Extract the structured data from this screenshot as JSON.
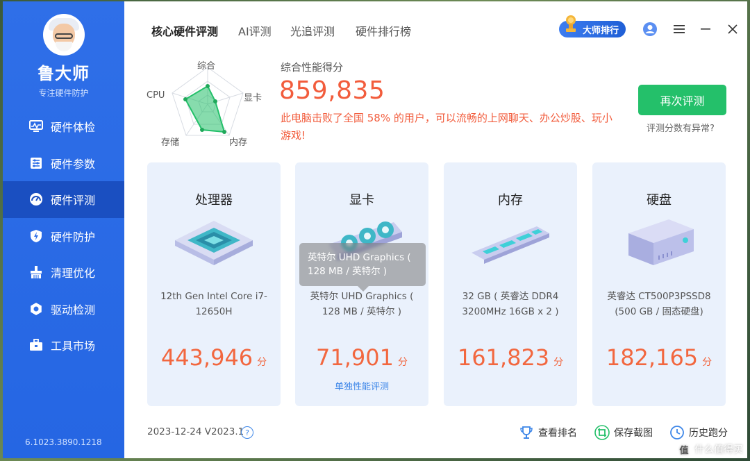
{
  "app": {
    "brand": "鲁大师",
    "subtitle": "专注硬件防护",
    "version": "6.1023.3890.1218"
  },
  "sidebar": {
    "items": [
      {
        "label": "硬件体检",
        "icon": "monitor-pulse-icon"
      },
      {
        "label": "硬件参数",
        "icon": "sliders-icon"
      },
      {
        "label": "硬件评测",
        "icon": "speedometer-icon",
        "active": true
      },
      {
        "label": "硬件防护",
        "icon": "shield-bolt-icon"
      },
      {
        "label": "清理优化",
        "icon": "broom-icon"
      },
      {
        "label": "驱动检测",
        "icon": "gear-icon"
      },
      {
        "label": "工具市场",
        "icon": "toolbox-icon"
      }
    ]
  },
  "tabs": [
    {
      "label": "核心硬件评测",
      "active": true
    },
    {
      "label": "AI评测"
    },
    {
      "label": "光追评测"
    },
    {
      "label": "硬件排行榜"
    }
  ],
  "topbar": {
    "rank_label": "大师排行"
  },
  "radar": {
    "labels": {
      "top": "综合",
      "left": "CPU",
      "right": "显卡",
      "bottom_left": "存储",
      "bottom_right": "内存"
    }
  },
  "summary": {
    "title": "综合性能得分",
    "score": "859,835",
    "description": "此电脑击败了全国 58% 的用户，可以流畅的上网聊天、办公炒股、玩小游戏!",
    "retest_label": "再次评测",
    "anomaly_link": "评测分数有异常?"
  },
  "cards": [
    {
      "title": "处理器",
      "desc": "12th Gen Intel Core i7-12650H",
      "score": "443,946",
      "unit": "分"
    },
    {
      "title": "显卡",
      "desc": "英特尔 UHD Graphics ( 128 MB / 英特尔 )",
      "score": "71,901",
      "unit": "分",
      "link": "单独性能评测"
    },
    {
      "title": "内存",
      "desc": "32 GB ( 英睿达 DDR4 3200MHz 16GB x 2 )",
      "score": "161,823",
      "unit": "分"
    },
    {
      "title": "硬盘",
      "desc": "英睿达 CT500P3PSSD8 (500 GB / 固态硬盘)",
      "score": "182,165",
      "unit": "分"
    }
  ],
  "tooltip": {
    "text": "英特尔 UHD Graphics ( 128 MB / 英特尔 )"
  },
  "footer": {
    "date": "2023-12-24 V2023.1",
    "help": "?",
    "view_rank": "查看排名",
    "save_screenshot": "保存截图",
    "history": "历史跑分",
    "watermark": "什么值得买",
    "watermark_logo": "值"
  },
  "colors": {
    "sidebar_bg": "#2f6fe8",
    "score_red": "#f25c3c",
    "retest_green": "#24c06a",
    "card_bg": "#eaf1fc"
  }
}
